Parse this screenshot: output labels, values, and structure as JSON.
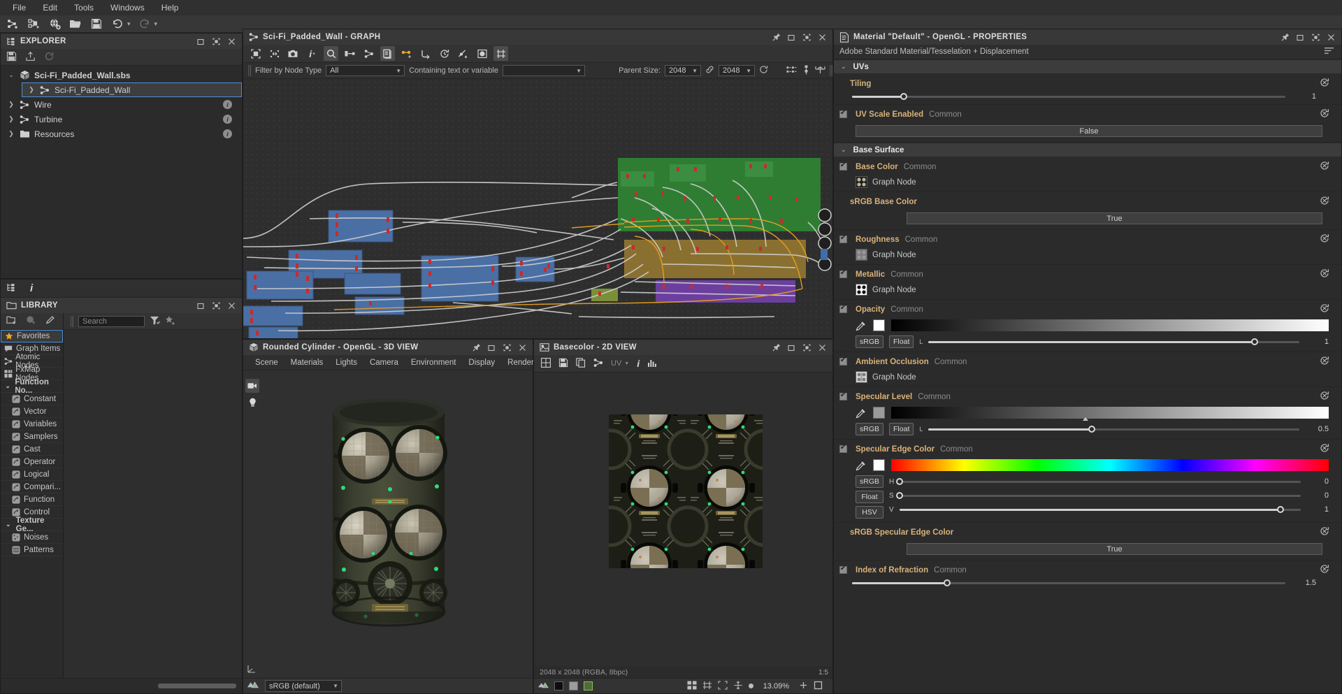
{
  "menubar": {
    "items": [
      "File",
      "Edit",
      "Tools",
      "Windows",
      "Help"
    ]
  },
  "main_toolbar": {
    "buttons": [
      {
        "name": "new-graph-icon",
        "title": "New Graph"
      },
      {
        "name": "new-substance-icon",
        "title": "New Substance"
      },
      {
        "name": "new-package-icon",
        "title": "New Package"
      },
      {
        "name": "open-folder-icon",
        "title": "Open"
      },
      {
        "name": "save-icon",
        "title": "Save"
      },
      {
        "name": "undo-icon",
        "title": "Undo"
      },
      {
        "name": "redo-icon",
        "title": "Redo"
      }
    ]
  },
  "explorer": {
    "title": "EXPLORER",
    "tools": [
      "save-icon",
      "export-icon",
      "refresh-icon"
    ],
    "tree": [
      {
        "label": "Sci-Fi_Padded_Wall.sbs",
        "icon": "package-icon",
        "level": 0,
        "expanded": true,
        "selected": false,
        "info": false
      },
      {
        "label": "Sci-Fi_Padded_Wall",
        "icon": "graph-icon",
        "level": 1,
        "expanded": false,
        "selected": true,
        "info": false
      },
      {
        "label": "Wire",
        "icon": "graph-icon",
        "level": 1,
        "expanded": false,
        "selected": false,
        "info": true
      },
      {
        "label": "Turbine",
        "icon": "graph-icon",
        "level": 1,
        "expanded": false,
        "selected": false,
        "info": true
      },
      {
        "label": "Resources",
        "icon": "folder-icon",
        "level": 1,
        "expanded": false,
        "selected": false,
        "info": true
      }
    ]
  },
  "library": {
    "title": "LIBRARY",
    "search": {
      "placeholder": "Search",
      "value": ""
    },
    "tools": [
      "new-folder-icon",
      "new-item-icon",
      "edit-icon"
    ],
    "categories": [
      {
        "label": "Favorites",
        "icon": "star-icon",
        "selected": true,
        "group": false,
        "child": false
      },
      {
        "label": "Graph Items",
        "icon": "comment-icon",
        "selected": false,
        "group": false,
        "child": false
      },
      {
        "label": "Atomic Nodes",
        "icon": "atomic-icon",
        "selected": false,
        "group": false,
        "child": false
      },
      {
        "label": "FxMap Nodes",
        "icon": "fxmap-icon",
        "selected": false,
        "group": false,
        "child": false
      },
      {
        "label": "Function No...",
        "icon": "chevron-down-icon",
        "selected": false,
        "group": true,
        "child": false
      },
      {
        "label": "Constant",
        "icon": "function-icon",
        "selected": false,
        "group": false,
        "child": true
      },
      {
        "label": "Vector",
        "icon": "function-icon",
        "selected": false,
        "group": false,
        "child": true
      },
      {
        "label": "Variables",
        "icon": "function-icon",
        "selected": false,
        "group": false,
        "child": true
      },
      {
        "label": "Samplers",
        "icon": "function-icon",
        "selected": false,
        "group": false,
        "child": true
      },
      {
        "label": "Cast",
        "icon": "function-icon",
        "selected": false,
        "group": false,
        "child": true
      },
      {
        "label": "Operator",
        "icon": "function-icon",
        "selected": false,
        "group": false,
        "child": true
      },
      {
        "label": "Logical",
        "icon": "function-icon",
        "selected": false,
        "group": false,
        "child": true
      },
      {
        "label": "Compari...",
        "icon": "function-icon",
        "selected": false,
        "group": false,
        "child": true
      },
      {
        "label": "Function",
        "icon": "function-icon",
        "selected": false,
        "group": false,
        "child": true
      },
      {
        "label": "Control",
        "icon": "function-icon",
        "selected": false,
        "group": false,
        "child": true
      },
      {
        "label": "Texture Ge...",
        "icon": "chevron-down-icon",
        "selected": false,
        "group": true,
        "child": false
      },
      {
        "label": "Noises",
        "icon": "texture-icon",
        "selected": false,
        "group": false,
        "child": true
      },
      {
        "label": "Patterns",
        "icon": "texture-icon",
        "selected": false,
        "group": false,
        "child": true
      }
    ]
  },
  "graph": {
    "title": "Sci-Fi_Padded_Wall - GRAPH",
    "toolbar_buttons": [
      {
        "name": "frame-all-icon",
        "active": false
      },
      {
        "name": "align-icon",
        "active": false
      },
      {
        "name": "camera-icon",
        "active": false
      },
      {
        "name": "info-icon",
        "active": false
      },
      {
        "name": "zoom-icon",
        "active": true
      },
      {
        "name": "input-node-icon",
        "active": false
      },
      {
        "name": "graph-node-icon",
        "active": false
      },
      {
        "name": "layers-icon",
        "active": true
      },
      {
        "name": "link-creation-icon",
        "active": false
      },
      {
        "name": "link-route-icon",
        "active": false
      },
      {
        "name": "history-icon",
        "active": false
      },
      {
        "name": "curve-icon",
        "active": false
      },
      {
        "name": "preview-icon",
        "active": false
      },
      {
        "name": "grid-snap-icon",
        "active": true
      }
    ],
    "filter_label": "Filter by Node Type",
    "filter_value": "All",
    "contains_label": "Containing text or variable",
    "contains_value": "",
    "parent_size_label": "Parent Size:",
    "parent_size_w": "2048",
    "parent_size_h": "2048",
    "right_buttons": [
      "compare-icon",
      "node-settings-icon",
      "histogram-icon"
    ]
  },
  "view3d": {
    "title": "Rounded Cylinder - OpenGL - 3D VIEW",
    "menu": [
      "Scene",
      "Materials",
      "Lights",
      "Camera",
      "Environment",
      "Display",
      "Renderer"
    ],
    "bottom": {
      "colorspace": "sRGB (default)",
      "icon": "colorspace-icon"
    },
    "side_tools": [
      "camera-icon",
      "light-icon"
    ],
    "corner_tool": "axis-icon"
  },
  "view2d": {
    "title": "Basecolor - 2D VIEW",
    "tools": [
      "grid-icon",
      "save-icon",
      "copy-icon",
      "link-icon",
      "uv-icon",
      "info-icon",
      "histogram-icon"
    ],
    "uv_label": "UV",
    "info": "2048 x 2048 (RGBA, 8bpc)",
    "bottom_tools": [
      "channels-icon",
      "gray-icon",
      "rgb-icon",
      "alpha-icon"
    ],
    "right_tools": [
      "tile-icon",
      "ratio-icon",
      "fit-icon",
      "pan-icon",
      "dot-icon"
    ],
    "zoom": "13.09%",
    "ratio": "1:5"
  },
  "properties": {
    "title": "Material \"Default\" - OpenGL - PROPERTIES",
    "subtitle": "Adobe Standard Material/Tesselation + Displacement",
    "sections": [
      {
        "name": "UVs",
        "rows": [
          {
            "type": "slider_simple",
            "name": "Tiling",
            "value": "1",
            "pos": 12
          },
          {
            "type": "bool_button",
            "name": "UV Scale Enabled",
            "common": "Common",
            "button": "False",
            "checked": true
          }
        ]
      },
      {
        "name": "Base Surface",
        "rows": [
          {
            "type": "graph_node",
            "name": "Base Color",
            "common": "Common",
            "node_label": "Graph Node",
            "checked": true,
            "thumb": "basecolor"
          },
          {
            "type": "bool_button_plain",
            "name": "sRGB Base Color",
            "button": "True"
          },
          {
            "type": "graph_node",
            "name": "Roughness",
            "common": "Common",
            "node_label": "Graph Node",
            "checked": true,
            "thumb": "roughness"
          },
          {
            "type": "graph_node",
            "name": "Metallic",
            "common": "Common",
            "node_label": "Graph Node",
            "checked": true,
            "thumb": "metallic"
          },
          {
            "type": "color_float",
            "name": "Opacity",
            "common": "Common",
            "checked": true,
            "swatch": "#ffffff",
            "mode1": "sRGB",
            "mode2": "Float",
            "slider_label": "L",
            "value": "1",
            "pos": 88
          },
          {
            "type": "graph_node",
            "name": "Ambient Occlusion",
            "common": "Common",
            "node_label": "Graph Node",
            "checked": true,
            "thumb": "ao"
          },
          {
            "type": "color_float",
            "name": "Specular Level",
            "common": "Common",
            "checked": true,
            "swatch": "#9a9a9a",
            "mode1": "sRGB",
            "mode2": "Float",
            "slider_label": "L",
            "value": "0.5",
            "pos": 44
          },
          {
            "type": "color_hsv",
            "name": "Specular Edge Color",
            "common": "Common",
            "checked": true,
            "swatch": "#ffffff",
            "mode1": "sRGB",
            "mode2": "Float",
            "mode3": "HSV",
            "hsv": [
              {
                "label": "H",
                "value": "0",
                "pos": 0
              },
              {
                "label": "S",
                "value": "0",
                "pos": 0
              },
              {
                "label": "V",
                "value": "1",
                "pos": 95
              }
            ]
          },
          {
            "type": "bool_button_plain",
            "name": "sRGB Specular Edge Color",
            "button": "True"
          },
          {
            "type": "label_only",
            "name": "Index of Refraction",
            "common": "Common",
            "checked": true,
            "value": "1.5",
            "pos": 22
          }
        ]
      }
    ],
    "colors": {
      "label": "#d9b27a",
      "common": "#8c8c8c",
      "section_bg": "#3c3c3c",
      "accent": "#4a90d9"
    }
  }
}
